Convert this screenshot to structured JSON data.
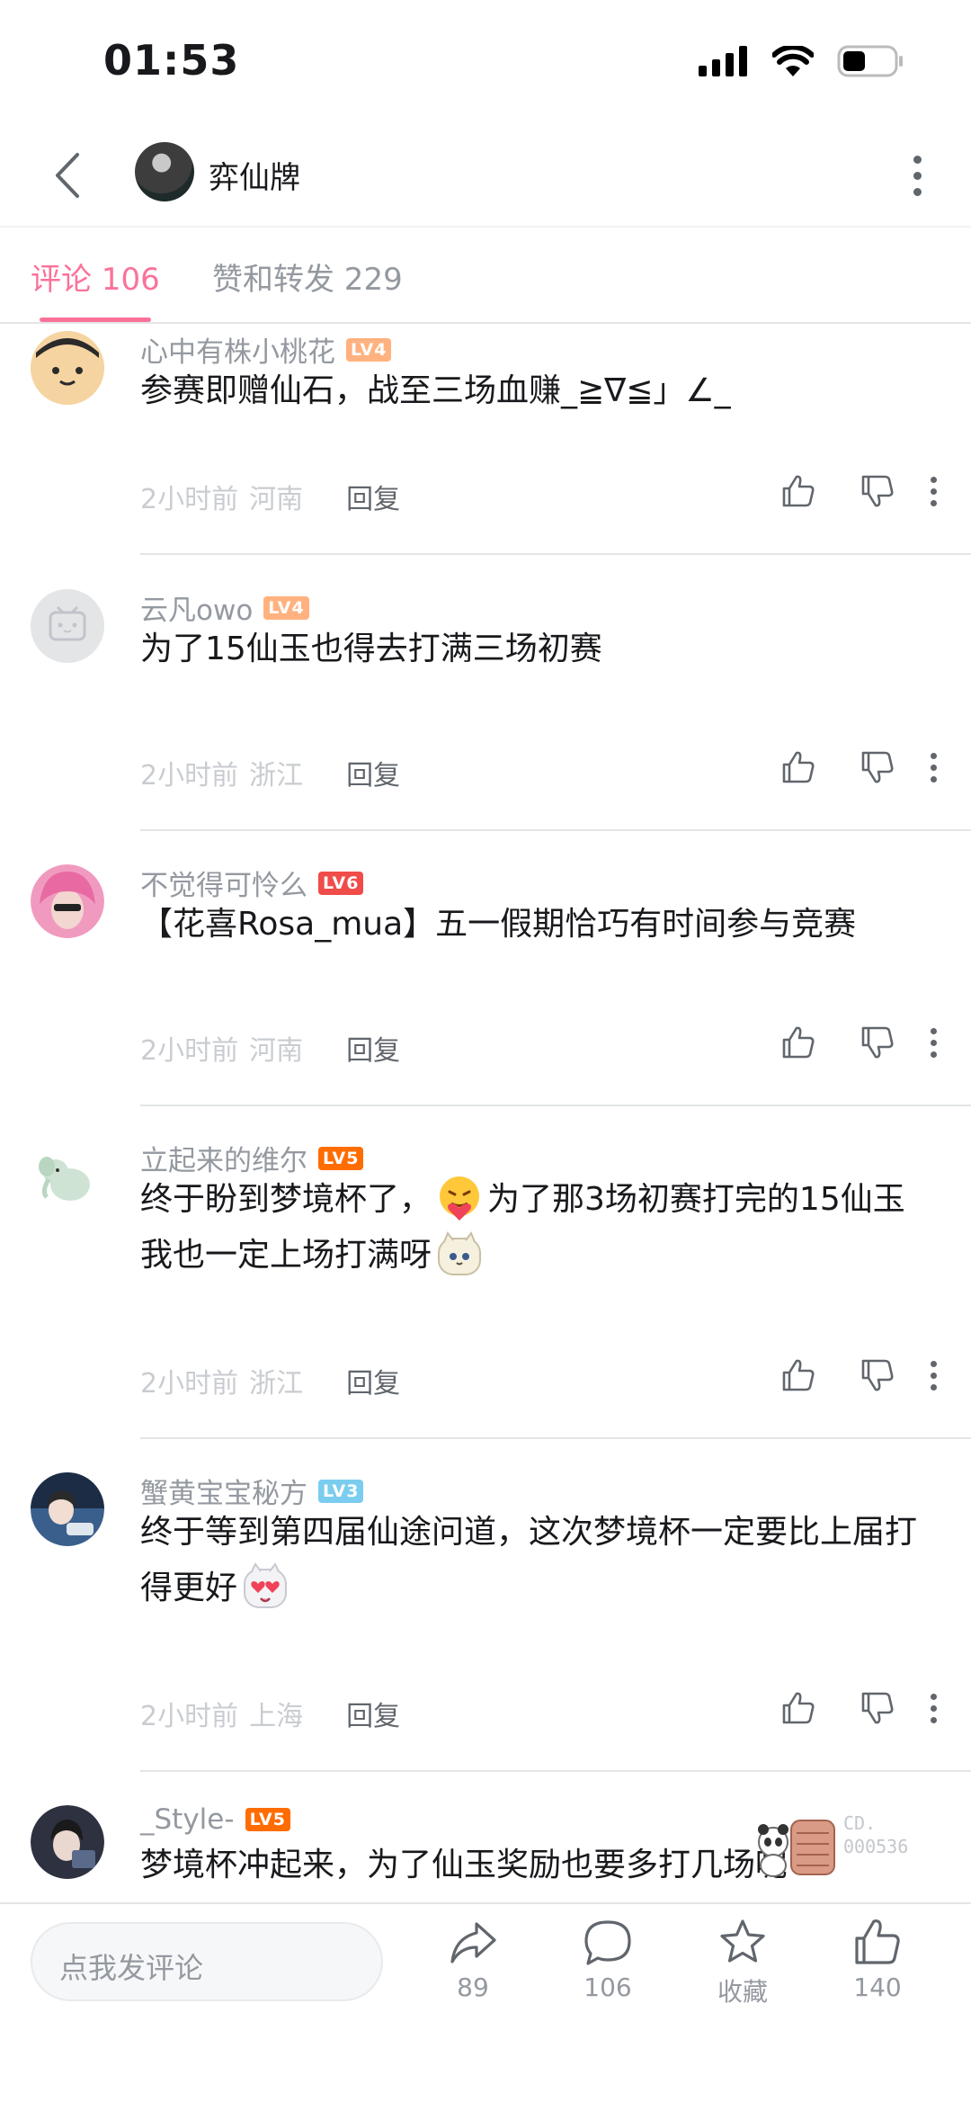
{
  "status_bar": {
    "time": "01:53"
  },
  "header": {
    "title": "弈仙牌"
  },
  "tabs": [
    {
      "label": "评论 106",
      "active": true
    },
    {
      "label": "赞和转发 229",
      "active": false
    }
  ],
  "comments": [
    {
      "username": "心中有株小桃花",
      "level": "LV4",
      "level_color": "#ffb27f",
      "text": "参赛即赠仙石，战至三场血赚_≧∇≦」∠_",
      "time": "2小时前",
      "region": "河南",
      "reply_label": "回复"
    },
    {
      "username": "云凡owo",
      "level": "LV4",
      "level_color": "#ffb27f",
      "text": "为了15仙玉也得去打满三场初赛",
      "time": "2小时前",
      "region": "浙江",
      "reply_label": "回复"
    },
    {
      "username": "不觉得可怜么",
      "level": "LV6",
      "level_color": "#f04c49",
      "text": "【花喜Rosa_mua】五一假期恰巧有时间参与竞赛",
      "time": "2小时前",
      "region": "河南",
      "reply_label": "回复"
    },
    {
      "username": "立起来的维尔",
      "level": "LV5",
      "level_color": "#ff6c00",
      "text_part1": "终于盼到梦境杯了，",
      "text_part2": "为了那3场初赛打完的15仙玉我也一定上场打满呀",
      "time": "2小时前",
      "region": "浙江",
      "reply_label": "回复"
    },
    {
      "username": "蟹黄宝宝秘方",
      "level": "LV3",
      "level_color": "#7bcdef",
      "text": "终于等到第四届仙途问道，这次梦境杯一定要比上届打得更好",
      "time": "2小时前",
      "region": "上海",
      "reply_label": "回复"
    },
    {
      "username": "_Style-",
      "level": "LV5",
      "level_color": "#ff6c00",
      "text": "梦境杯冲起来，为了仙玉奖励也要多打几场呢"
    }
  ],
  "watermark": {
    "line1": "CD.",
    "line2": "000536"
  },
  "bottom_bar": {
    "input_placeholder": "点我发评论",
    "share_count": "89",
    "comment_count": "106",
    "favorite_label": "收藏",
    "like_count": "140"
  }
}
